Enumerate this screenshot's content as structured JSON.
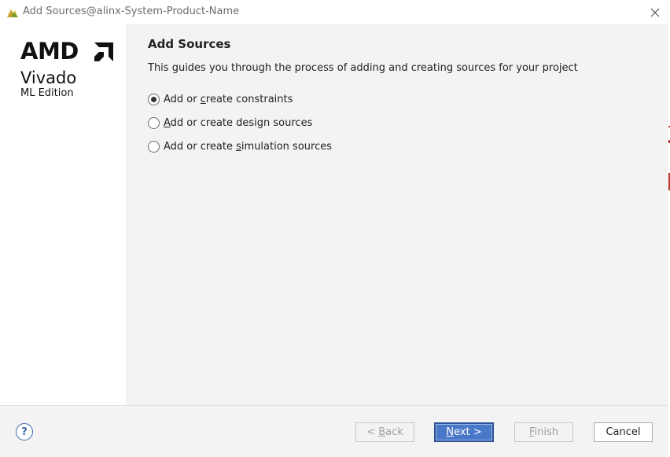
{
  "window": {
    "title": "Add Sources@alinx-System-Product-Name",
    "app_icon": "vivado-logo-icon",
    "close_icon": "close-icon"
  },
  "branding": {
    "company": "AMD",
    "logo_icon": "amd-arrow-logo-icon",
    "product": "Vivado",
    "edition": "ML Edition"
  },
  "page": {
    "title": "Add Sources",
    "description": "This guides you through the process of adding and creating sources for your project"
  },
  "options": [
    {
      "pre": "Add or ",
      "mnemonic": "c",
      "post": "reate constraints",
      "checked": true
    },
    {
      "pre": "",
      "mnemonic": "A",
      "post": "dd or create design sources",
      "checked": false
    },
    {
      "pre": "Add or create ",
      "mnemonic": "s",
      "post": "imulation sources",
      "checked": false
    }
  ],
  "footer": {
    "help_label": "?",
    "back": {
      "pre": "< ",
      "mnemonic": "B",
      "post": "ack",
      "enabled": false
    },
    "next": {
      "pre": "",
      "mnemonic": "N",
      "post": "ext >",
      "enabled": true
    },
    "finish": {
      "pre": "",
      "mnemonic": "F",
      "post": "inish",
      "enabled": false
    },
    "cancel": {
      "label": "Cancel",
      "enabled": true
    }
  },
  "colors": {
    "primary_button": "#4a78c8",
    "help_accent": "#3b6aa8",
    "panel_bg": "#f3f3f3"
  }
}
